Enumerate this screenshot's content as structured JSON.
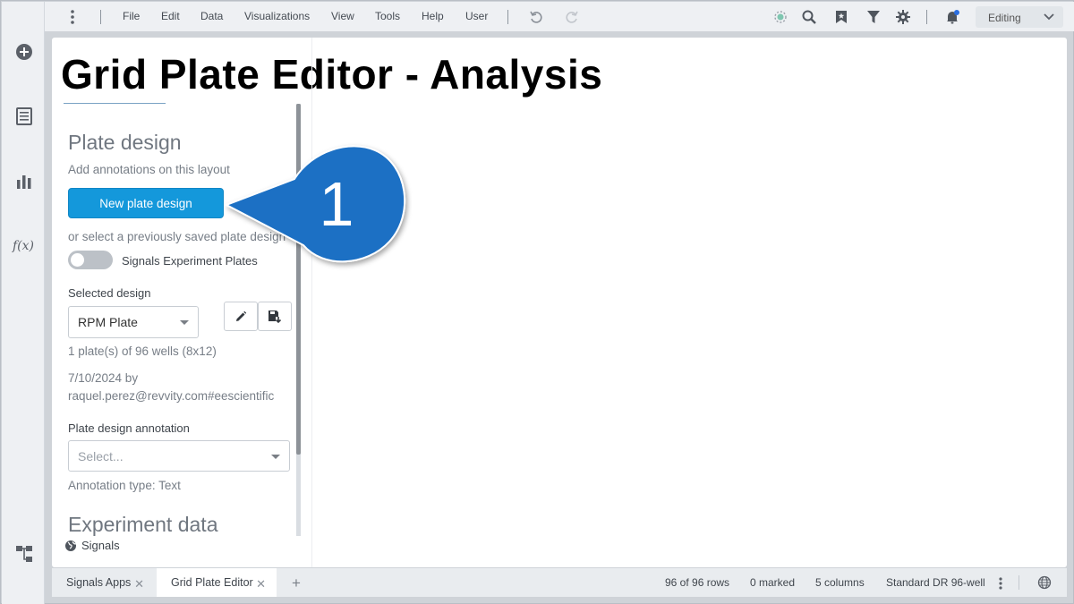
{
  "menubar": {
    "items": [
      "File",
      "Edit",
      "Data",
      "Visualizations",
      "View",
      "Tools",
      "Help",
      "User"
    ],
    "mode": "Editing",
    "icons": [
      "undo-icon",
      "redo-icon",
      "ai-assistant-icon",
      "search-icon",
      "bookmark-icon",
      "filter-icon",
      "settings-icon",
      "notifications-icon"
    ],
    "notification_dot_color": "#2a6ee0"
  },
  "rail": {
    "icons": [
      "add-icon",
      "data-table-icon",
      "visualizations-icon",
      "function-icon",
      "data-canvas-icon"
    ],
    "function_label": "f(x)"
  },
  "page": {
    "title": "Grid Plate Editor - Analysis"
  },
  "panel": {
    "section_title": "Plate design",
    "subtitle": "Add annotations on this layout",
    "new_design_button": "New plate design",
    "select_previous": "or select a previously saved plate design",
    "toggle_label": "Signals Experiment Plates",
    "toggle_on": false,
    "selected_design_label": "Selected design",
    "selected_design_value": "RPM Plate",
    "plates_info": "1 plate(s) of 96 wells (8x12)",
    "saved_date": "7/10/2024 by",
    "saved_by": "raquel.perez@revvity.com#eescientific",
    "annotation_label": "Plate design annotation",
    "annotation_placeholder": "Select...",
    "annotation_type": "Annotation type: Text",
    "experiment_section_title": "Experiment data",
    "footer_link": "Signals",
    "accent_color": "#1498db"
  },
  "callout": {
    "number": "1",
    "color": "#1b6fc4"
  },
  "tabs": [
    {
      "label": "Signals Apps",
      "active": false
    },
    {
      "label": "Grid Plate Editor",
      "active": true
    }
  ],
  "statusbar": {
    "rows": "96 of 96 rows",
    "marked": "0 marked",
    "columns": "5 columns",
    "filter_scheme": "Standard DR 96-well"
  }
}
